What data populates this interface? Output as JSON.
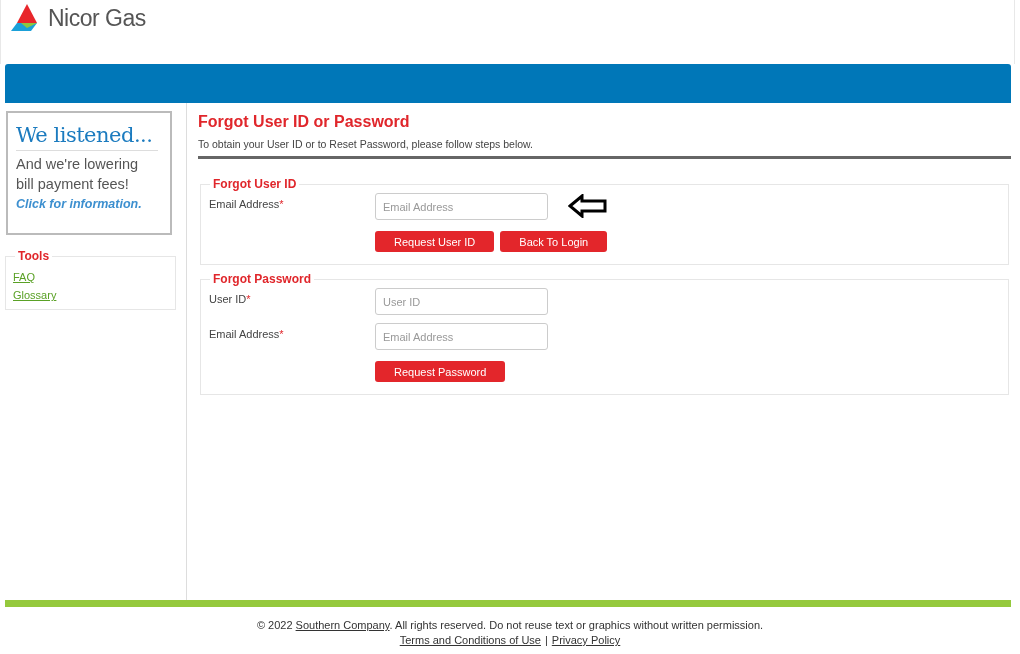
{
  "logo": {
    "name": "Nicor Gas"
  },
  "promo": {
    "title": "We listened...",
    "body": "And we're lowering bill payment fees!",
    "link": "Click for information."
  },
  "tools": {
    "title": "Tools",
    "links": [
      "FAQ",
      "Glossary"
    ]
  },
  "page": {
    "title": "Forgot User ID or Password",
    "intro": "To obtain your User ID or to Reset Password, please follow steps below."
  },
  "sections": [
    {
      "legend": "Forgot User ID",
      "arrow": true,
      "fields": [
        {
          "label": "Email Address",
          "required_mark": "*",
          "placeholder": "Email Address"
        }
      ],
      "buttons": [
        "Request User ID",
        "Back To Login"
      ]
    },
    {
      "legend": "Forgot Password",
      "arrow": false,
      "fields": [
        {
          "label": "User ID",
          "required_mark": "*",
          "placeholder": "User ID"
        },
        {
          "label": "Email Address",
          "required_mark": "*",
          "placeholder": "Email Address"
        }
      ],
      "buttons": [
        "Request Password"
      ]
    }
  ],
  "footer": {
    "prefix": "© 2022 ",
    "company": "Southern Company",
    "suffix": ". All rights reserved. Do not reuse text or graphics without written permission.",
    "links": [
      "Terms and Conditions of Use",
      "Privacy Policy"
    ],
    "separator": "|"
  }
}
